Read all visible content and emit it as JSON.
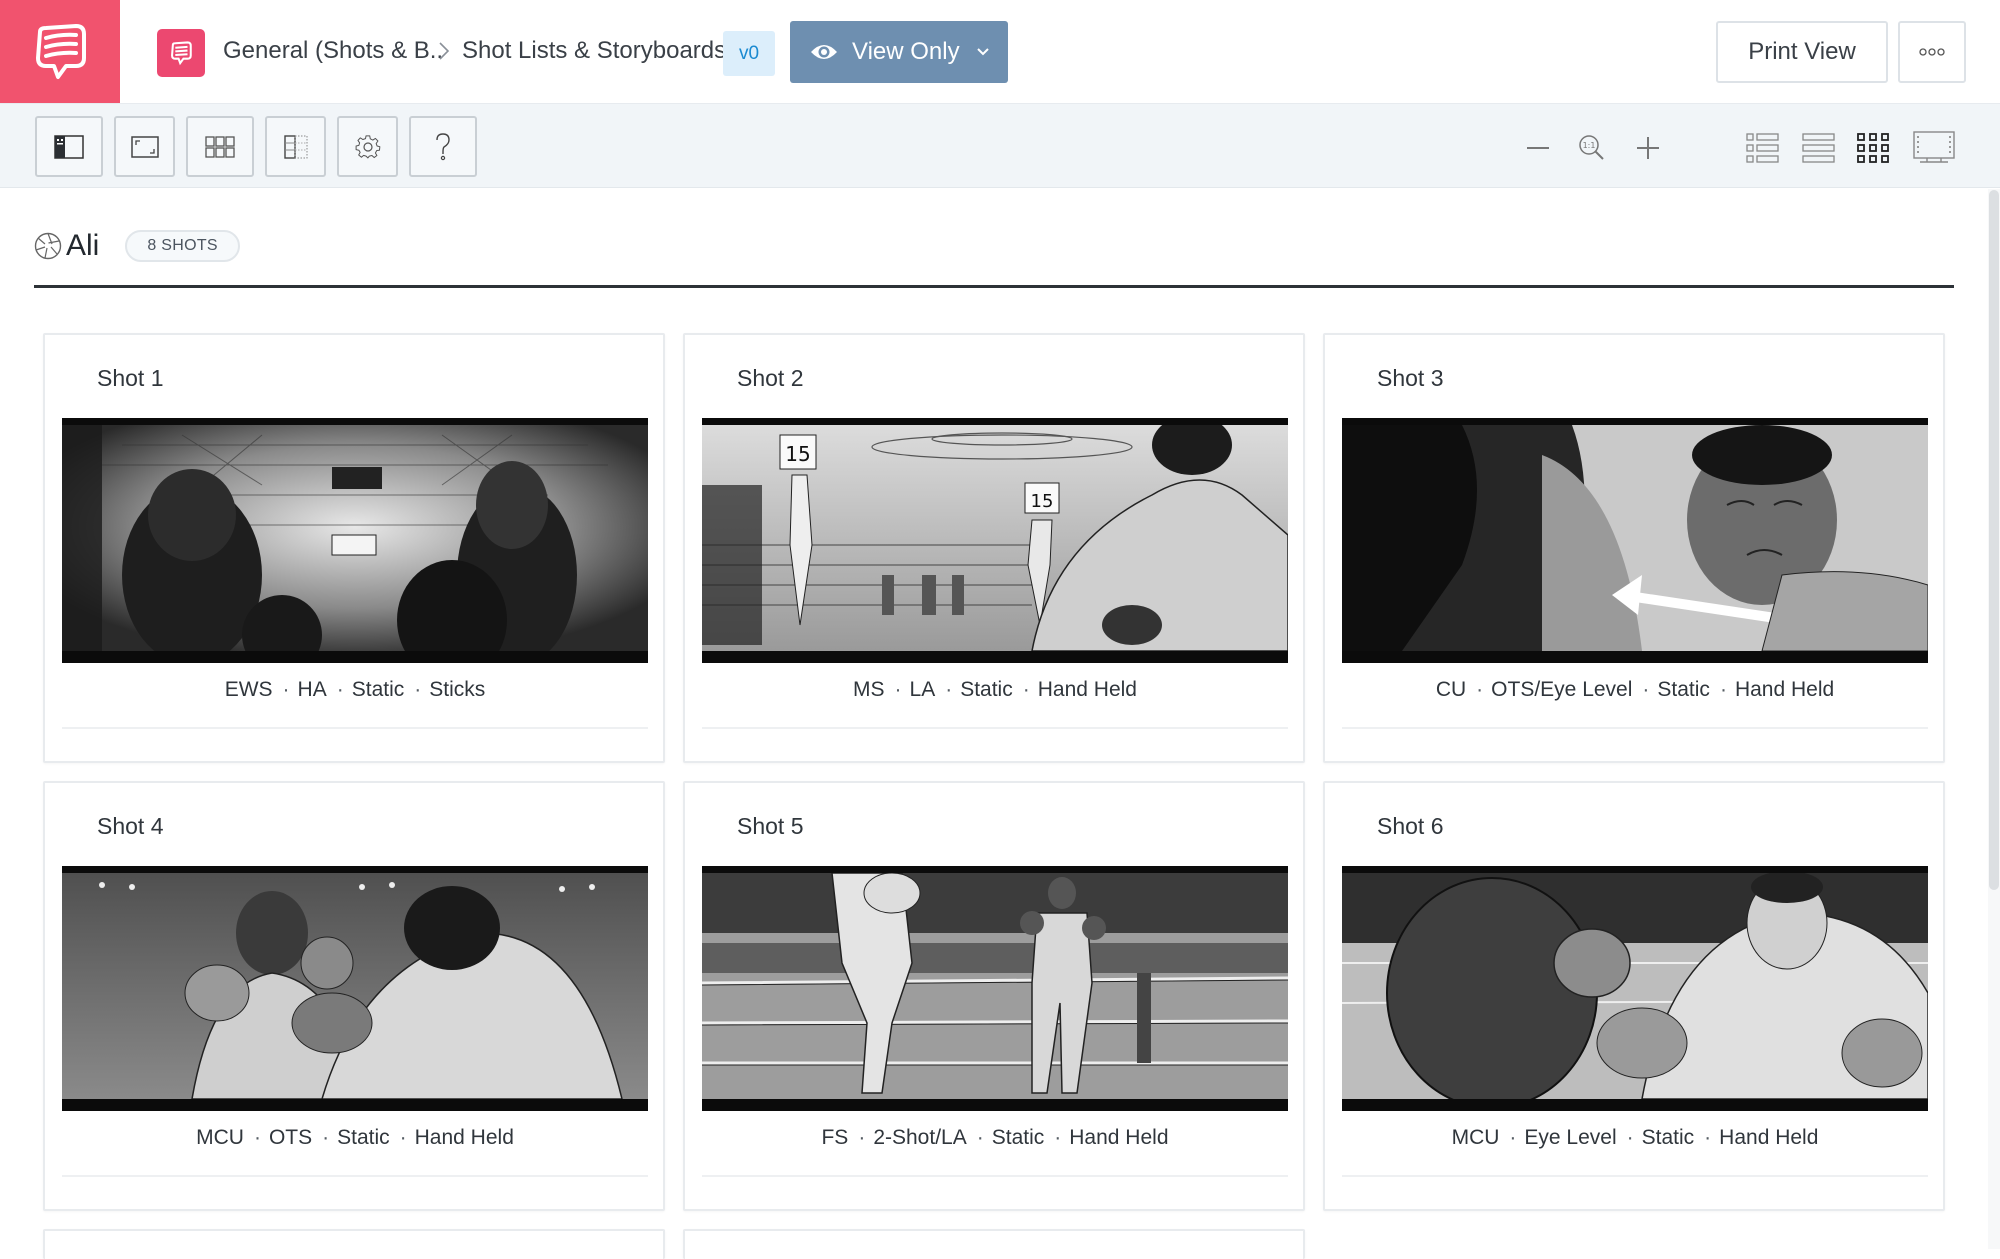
{
  "app": {
    "brand_color": "#f1536e",
    "logo_icon": "speech-bubble-icon"
  },
  "header": {
    "project_icon": "speech-bubble-icon",
    "breadcrumb": [
      {
        "label": "General (Shots & B.."
      },
      {
        "label": "Shot Lists & Storyboards"
      }
    ],
    "breadcrumb_separator_icon": "chevron-right-icon",
    "version": "v0",
    "view_mode_button": {
      "label": "View Only",
      "icon": "eye-icon",
      "dropdown_icon": "chevron-down-icon",
      "color": "#6e8fb0"
    },
    "print_button": {
      "label": "Print View"
    },
    "more_button": {
      "icon": "more-dots-icon"
    }
  },
  "toolbar": {
    "left_tools": [
      {
        "name": "toggle-sidebar",
        "icon": "sidebar-panel-icon"
      },
      {
        "name": "aspect-ratio",
        "icon": "frame-ratio-icon"
      },
      {
        "name": "grid-layout",
        "icon": "grid-icon"
      },
      {
        "name": "columns",
        "icon": "columns-icon"
      },
      {
        "name": "settings",
        "icon": "gear-icon"
      },
      {
        "name": "help",
        "icon": "question-icon"
      }
    ],
    "zoom_controls": [
      {
        "name": "zoom-out",
        "icon": "minus-icon"
      },
      {
        "name": "zoom-reset",
        "icon": "magnifier-1-1-icon",
        "label": "1:1"
      },
      {
        "name": "zoom-in",
        "icon": "plus-icon"
      }
    ],
    "view_modes": [
      {
        "name": "list-with-thumbs",
        "icon": "list-thumbs-icon",
        "active": false
      },
      {
        "name": "list",
        "icon": "list-rows-icon",
        "active": false
      },
      {
        "name": "grid",
        "icon": "grid-3x3-icon",
        "active": true
      },
      {
        "name": "presentation",
        "icon": "filmstrip-screen-icon",
        "active": false
      }
    ]
  },
  "scene": {
    "icon": "aperture-icon",
    "title": "Ali",
    "shot_count_label": "8 SHOTS"
  },
  "shots": [
    {
      "title": "Shot 1",
      "tags": [
        "EWS",
        "HA",
        "Static",
        "Sticks"
      ],
      "image_description": "Storyboard sketch: spectators viewed from behind overlooking a packed arena toward the boxing ring"
    },
    {
      "title": "Shot 2",
      "tags": [
        "MS",
        "LA",
        "Static",
        "Hand Held"
      ],
      "image_description": "Storyboard sketch: ring girls holding round 15 cards, boxer in foreground at right"
    },
    {
      "title": "Shot 3",
      "tags": [
        "CU",
        "OTS/Eye Level",
        "Static",
        "Hand Held"
      ],
      "image_description": "Storyboard sketch: close-up of boxer's face over opponent's shoulder, motion arrow"
    },
    {
      "title": "Shot 4",
      "tags": [
        "MCU",
        "OTS",
        "Static",
        "Hand Held"
      ],
      "image_description": "Storyboard sketch: two boxers exchanging blows in medium close-up"
    },
    {
      "title": "Shot 5",
      "tags": [
        "FS",
        "2-Shot/LA",
        "Static",
        "Hand Held"
      ],
      "image_description": "Storyboard sketch: full shot of two boxers in the ring behind the ropes"
    },
    {
      "title": "Shot 6",
      "tags": [
        "MCU",
        "Eye Level",
        "Static",
        "Hand Held"
      ],
      "image_description": "Storyboard sketch: boxer throwing a punch toward camera over opponent's head"
    },
    {
      "title": "",
      "tags": [],
      "image_description": ""
    },
    {
      "title": "",
      "tags": [],
      "image_description": ""
    }
  ]
}
